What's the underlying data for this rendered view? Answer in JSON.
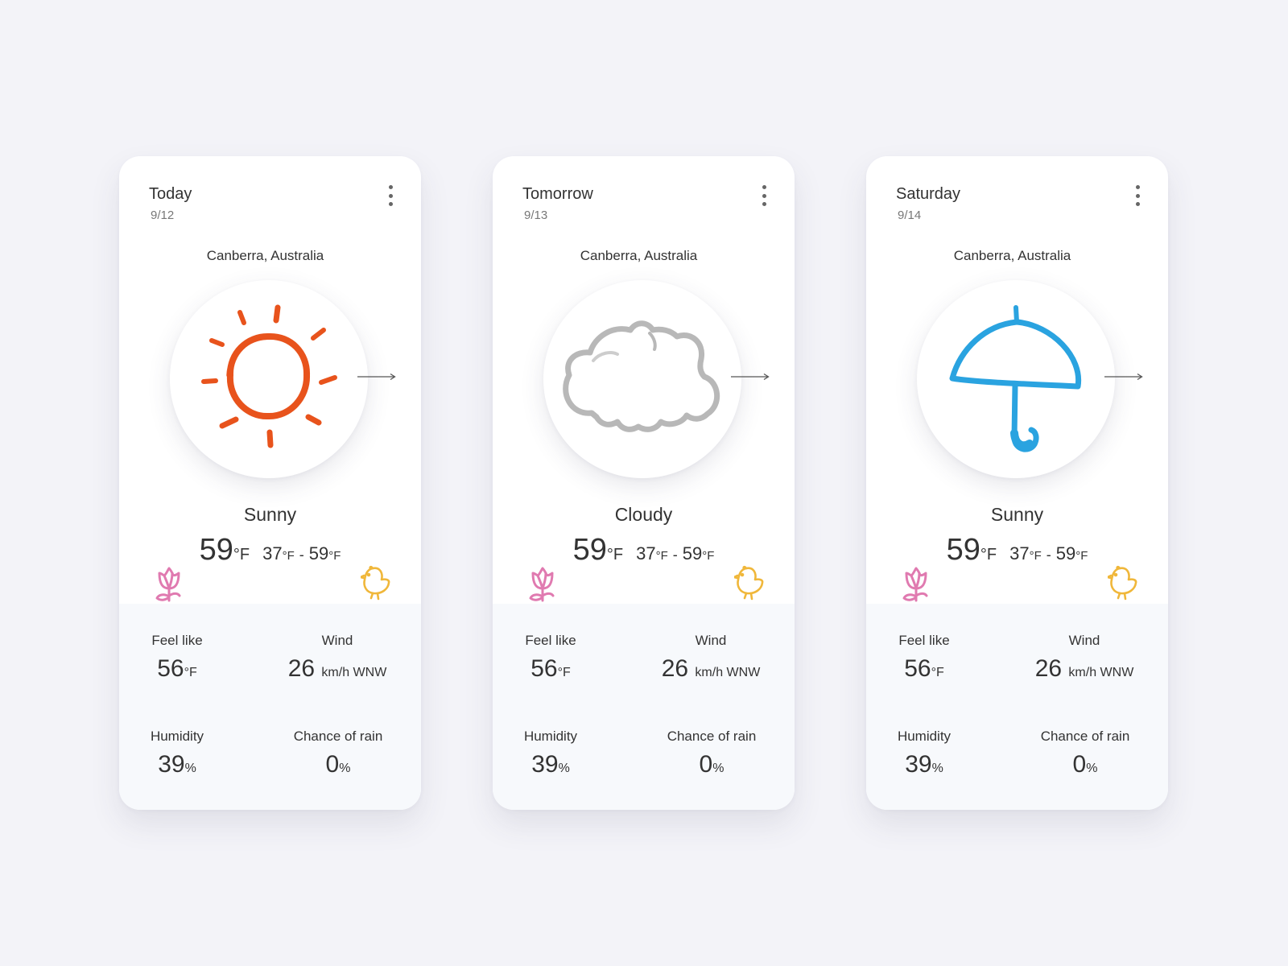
{
  "colors": {
    "background": "#f3f3f8",
    "sun": "#e8531c",
    "cloud": "#b8b8b8",
    "umbrella": "#2aa3e0",
    "flower": "#e07ab0",
    "chick": "#f0b73a"
  },
  "cards": [
    {
      "day": "Today",
      "date": "9/12",
      "location": "Canberra, Australia",
      "icon": "sun-icon",
      "condition": "Sunny",
      "temp": "59",
      "temp_unit": "°F",
      "low": "37",
      "low_unit": "°F",
      "dash": "-",
      "high": "59",
      "high_unit": "°F",
      "feel_label": "Feel like",
      "feel_value": "56",
      "feel_unit": "°F",
      "wind_label": "Wind",
      "wind_value": "26",
      "wind_unit": "km/h WNW",
      "humidity_label": "Humidity",
      "humidity_value": "39",
      "humidity_unit": "%",
      "rain_label": "Chance of rain",
      "rain_value": "0",
      "rain_unit": "%"
    },
    {
      "day": "Tomorrow",
      "date": "9/13",
      "location": "Canberra, Australia",
      "icon": "cloud-icon",
      "condition": "Cloudy",
      "temp": "59",
      "temp_unit": "°F",
      "low": "37",
      "low_unit": "°F",
      "dash": "-",
      "high": "59",
      "high_unit": "°F",
      "feel_label": "Feel like",
      "feel_value": "56",
      "feel_unit": "°F",
      "wind_label": "Wind",
      "wind_value": "26",
      "wind_unit": "km/h WNW",
      "humidity_label": "Humidity",
      "humidity_value": "39",
      "humidity_unit": "%",
      "rain_label": "Chance of rain",
      "rain_value": "0",
      "rain_unit": "%"
    },
    {
      "day": "Saturday",
      "date": "9/14",
      "location": "Canberra, Australia",
      "icon": "umbrella-icon",
      "condition": "Sunny",
      "temp": "59",
      "temp_unit": "°F",
      "low": "37",
      "low_unit": "°F",
      "dash": "-",
      "high": "59",
      "high_unit": "°F",
      "feel_label": "Feel like",
      "feel_value": "56",
      "feel_unit": "°F",
      "wind_label": "Wind",
      "wind_value": "26",
      "wind_unit": "km/h WNW",
      "humidity_label": "Humidity",
      "humidity_value": "39",
      "humidity_unit": "%",
      "rain_label": "Chance of rain",
      "rain_value": "0",
      "rain_unit": "%"
    }
  ]
}
